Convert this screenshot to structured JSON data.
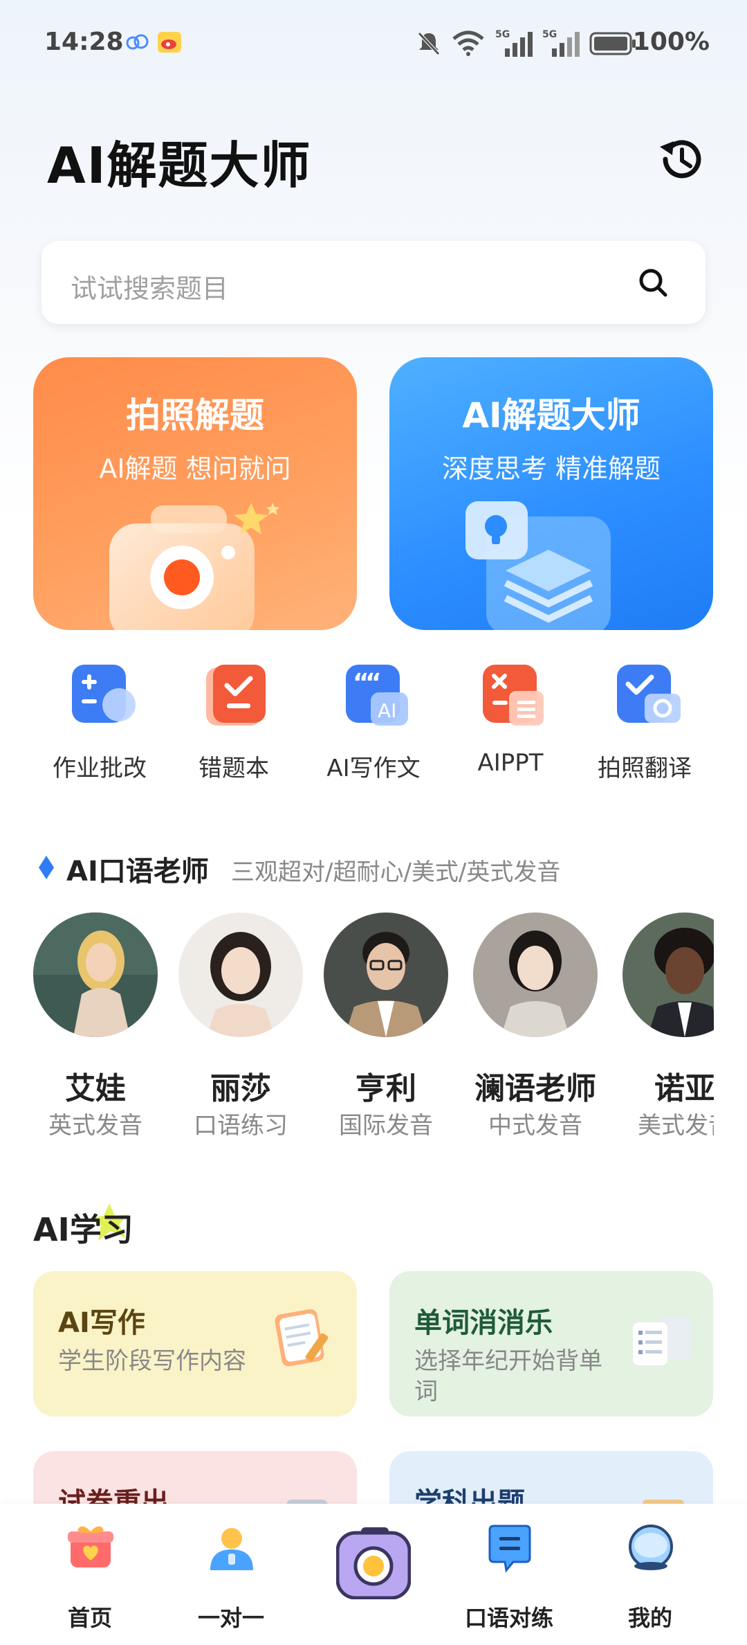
{
  "status_bar": {
    "time": "14:28",
    "battery": "100%",
    "signal_1": "5G",
    "signal_2": "5G"
  },
  "header": {
    "title": "AI解题大师"
  },
  "search": {
    "placeholder": "试试搜索题目"
  },
  "feature_cards": [
    {
      "title": "拍照解题",
      "subtitle": "AI解题  想问就问"
    },
    {
      "title": "AI解题大师",
      "subtitle": "深度思考  精准解题"
    }
  ],
  "tools": [
    {
      "label": "作业批改"
    },
    {
      "label": "错题本"
    },
    {
      "label": "AI写作文"
    },
    {
      "label": "AIPPT"
    },
    {
      "label": "拍照翻译"
    }
  ],
  "speaking_section": {
    "title": "AI口语老师",
    "subtitle": "三观超对/超耐心/美式/英式发音"
  },
  "teachers": [
    {
      "name": "艾娃",
      "desc": "英式发音"
    },
    {
      "name": "丽莎",
      "desc": "口语练习"
    },
    {
      "name": "亨利",
      "desc": "国际发音"
    },
    {
      "name": "澜语老师",
      "desc": "中式发音"
    },
    {
      "name": "诺亚",
      "desc": "美式发音"
    }
  ],
  "study_section": {
    "title": "AI学习"
  },
  "study_cards": [
    {
      "title": "AI写作",
      "desc": "学生阶段写作内容"
    },
    {
      "title": "单词消消乐",
      "desc": "选择年纪开始背单词"
    },
    {
      "title": "试卷重出",
      "desc": ""
    },
    {
      "title": "学科出题",
      "desc": ""
    }
  ],
  "bottom_nav": [
    {
      "label": "首页"
    },
    {
      "label": "一对一"
    },
    {
      "label": ""
    },
    {
      "label": "口语对练"
    },
    {
      "label": "我的"
    }
  ],
  "colors": {
    "photo_card": "#ff8b4a",
    "ai_card": "#2b8dff",
    "accent_blue": "#2f7cf6",
    "study_yellow": "#fbf3c8",
    "study_green": "#e3f2e1",
    "study_pink": "#fbe3e3",
    "study_blue": "#e3eefb"
  }
}
